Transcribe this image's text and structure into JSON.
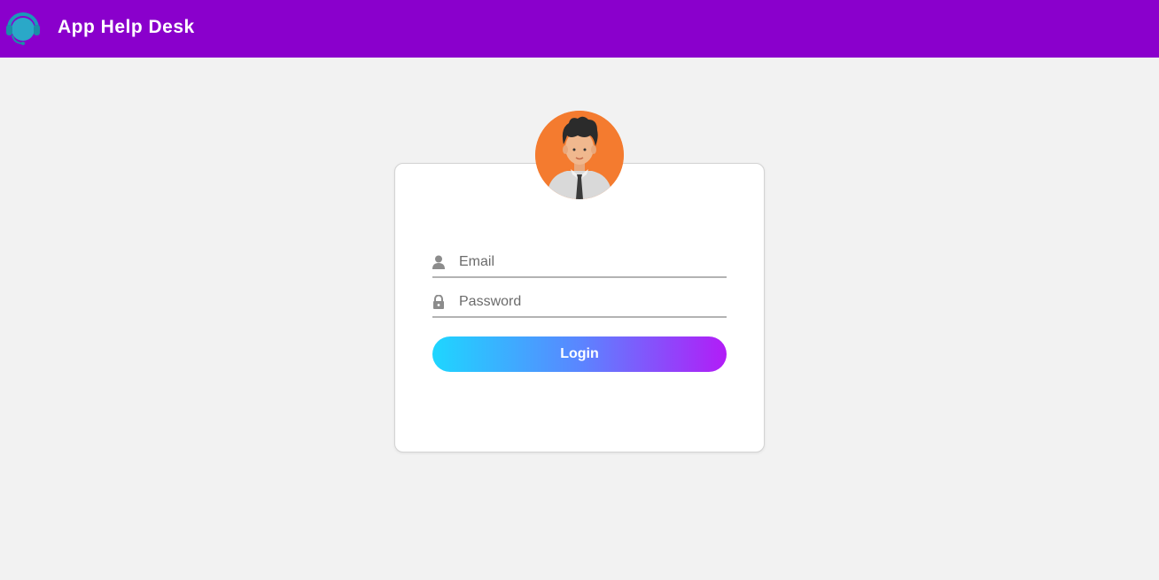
{
  "header": {
    "logo_icon": "headset-support-icon",
    "title": "App Help Desk",
    "background_color": "#8a00cc"
  },
  "login_card": {
    "avatar_icon": "user-avatar-icon",
    "email": {
      "icon": "user-icon",
      "placeholder": "Email",
      "value": ""
    },
    "password": {
      "icon": "lock-icon",
      "placeholder": "Password",
      "value": ""
    },
    "login_button": {
      "label": "Login",
      "gradient_start": "#1ed6ff",
      "gradient_end": "#b21cf7"
    }
  }
}
